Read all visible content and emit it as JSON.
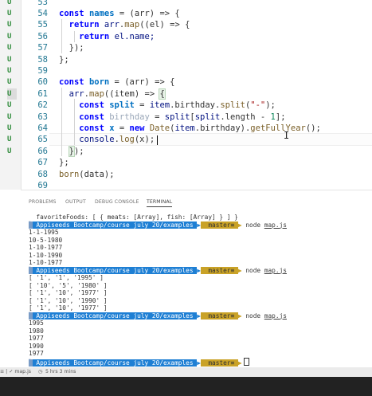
{
  "editor": {
    "line_numbers": [
      "53",
      "54",
      "55",
      "56",
      "57",
      "58",
      "59",
      "60",
      "61",
      "62",
      "63",
      "64",
      "65",
      "66",
      "67",
      "68",
      "69"
    ],
    "scm_marker": "U",
    "code": {
      "l54": {
        "kw": "const",
        "name": "names",
        "rest": " = (arr) => {"
      },
      "l55": {
        "kw": "return",
        "obj": "arr",
        "dot": ".",
        "fn": "map",
        "rest": "((el) => {"
      },
      "l56": {
        "kw": "return",
        "expr": "el.name;"
      },
      "l57": "});",
      "l58": "};",
      "l60": {
        "kw": "const",
        "name": "born",
        "rest": " = (arr) => {"
      },
      "l61": {
        "obj": "arr",
        "dot": ".",
        "fn": "map",
        "rest": "((item) => ",
        "brace": "{"
      },
      "l62": {
        "kw": "const",
        "name": "split",
        "eq": " = ",
        "obj": "item",
        "mid": ".birthday.",
        "fn": "split",
        "open": "(",
        "str": "\"-\"",
        "close": ");"
      },
      "l63": {
        "kw": "const",
        "name": "birthday",
        "eq": " = ",
        "obj": "split",
        "mid": "[",
        "obj2": "split",
        "mid2": ".length - ",
        "num": "1",
        "close": "];"
      },
      "l64": {
        "kw": "const",
        "name": "x",
        "eq": " = ",
        "kw2": "new",
        "fn": "Date",
        "open": "(",
        "obj": "item",
        "mid": ".birthday).",
        "fn2": "getFullYear",
        "close": "();"
      },
      "l65": {
        "obj": "console",
        "dot": ".",
        "fn": "log",
        "rest": "(x);"
      },
      "l66": {
        "brace": "}",
        "rest": ");"
      },
      "l67": "};",
      "l68": {
        "fn": "born",
        "rest": "(data);"
      }
    }
  },
  "panel": {
    "tabs": [
      "PROBLEMS",
      "OUTPUT",
      "DEBUG CONSOLE",
      "TERMINAL"
    ]
  },
  "terminal": {
    "first_line": "  favoriteFoods: [ { meats: [Array], fish: [Array] } ] }",
    "prompt_path": " Appiseeds Bootcamp/course july 20/examples ",
    "prompt_branch": "  master≡ ",
    "command": "node",
    "command_arg": "map.js",
    "output1": [
      "1-1-1995",
      "10-5-1980",
      "1-10-1977",
      "1-10-1990",
      "1-10-1977"
    ],
    "output2": [
      "[ '1', '1', '1995' ]",
      "[ '10', '5', '1980' ]",
      "[ '1', '10', '1977' ]",
      "[ '1', '10', '1990' ]",
      "[ '1', '10', '1977' ]"
    ],
    "output3": [
      "1995",
      "1980",
      "1977",
      "1990",
      "1977"
    ]
  },
  "status_bar": {
    "left_text": "≡ | ✓ map.js",
    "timer_text": "5 hrs 3 mins"
  },
  "colors": {
    "accent": "#1e7fd4",
    "branch": "#c9a227",
    "keyword": "#0000ff",
    "string": "#a31515",
    "number": "#098658"
  }
}
